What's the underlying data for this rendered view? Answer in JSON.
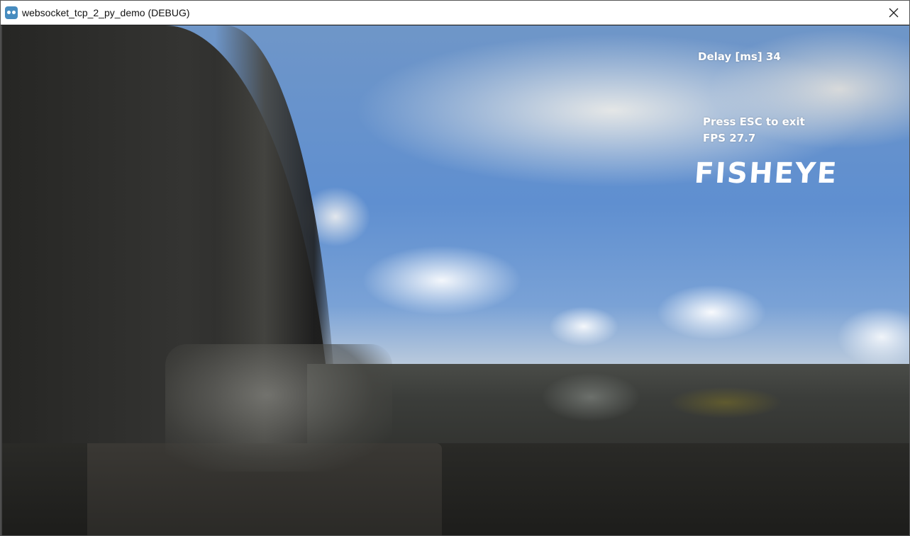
{
  "window": {
    "title": "websocket_tcp_2_py_demo (DEBUG)",
    "app_icon": "godot-icon",
    "close_icon": "close-icon"
  },
  "overlay": {
    "delay": "Delay [ms] 34",
    "press_esc": "Press ESC to exit",
    "fps": "FPS 27.7",
    "mode_label": "FISHEYE"
  },
  "colors": {
    "titlebar_bg": "#ffffff",
    "overlay_text": "#ffffff",
    "sky_blue": "#5f8fd0"
  }
}
